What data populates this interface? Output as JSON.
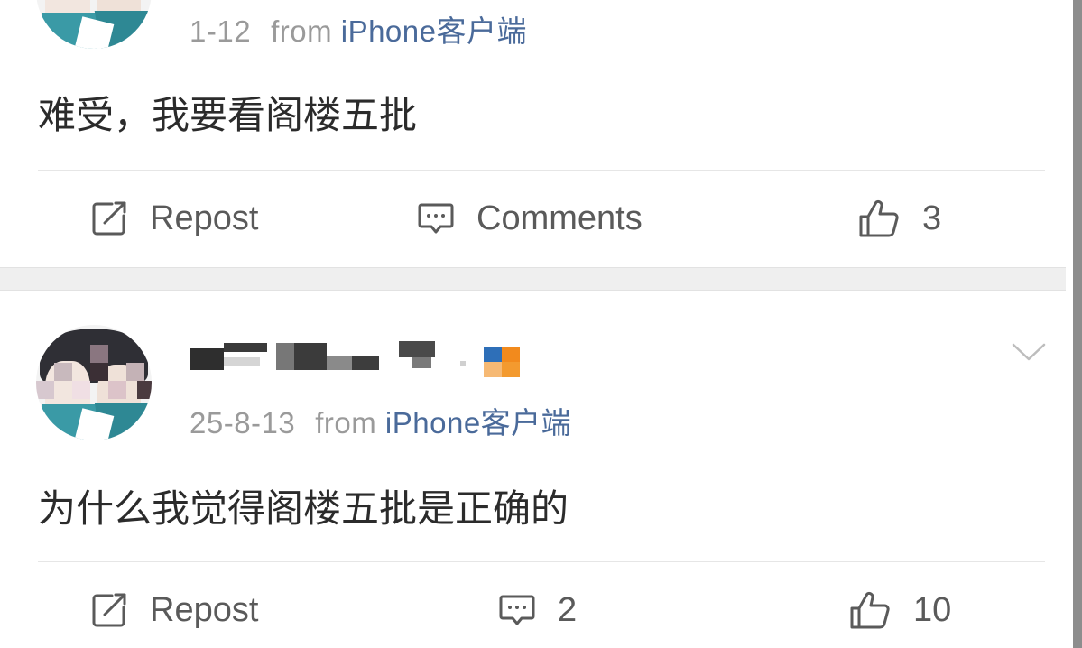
{
  "posts": [
    {
      "date": "1-12",
      "from_label": "from",
      "source": "iPhone客户端",
      "content": "难受，我要看阁楼五批",
      "actions": {
        "repost_label": "Repost",
        "comments_label": "Comments",
        "likes": "3"
      }
    },
    {
      "date": "25-8-13",
      "from_label": "from",
      "source": "iPhone客户端",
      "content": "为什么我觉得阁楼五批是正确的",
      "actions": {
        "repost_label": "Repost",
        "comments_label": "2",
        "likes": "10"
      }
    }
  ],
  "icons": {
    "repost": "repost-icon",
    "comments": "comment-icon",
    "like": "thumbs-up-icon",
    "more": "chevron-down-icon"
  },
  "colors": {
    "source_link": "#4a6a9a",
    "meta_gray": "#9a9a9a",
    "text": "#2b2b2b",
    "divider_band": "#efefef"
  }
}
